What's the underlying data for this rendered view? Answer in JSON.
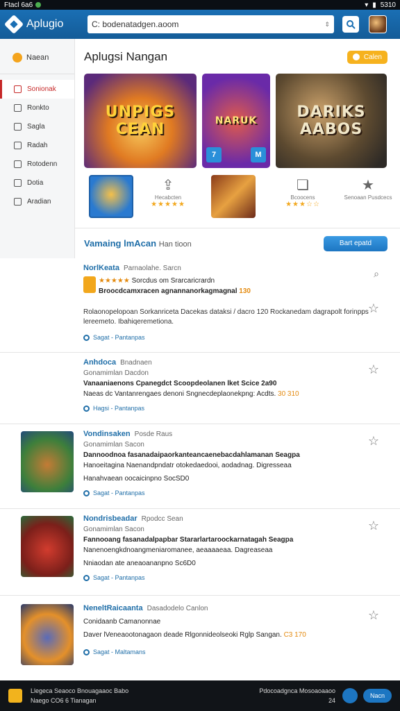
{
  "status": {
    "time": "Ftacl 6a6",
    "right": "5310"
  },
  "appbar": {
    "logo_text": "Aplugio",
    "search_value": "C: bodenatadgen.aoom"
  },
  "sidebar": {
    "top_label": "Naean",
    "items": [
      {
        "label": "Sonionak"
      },
      {
        "label": "Ronkto"
      },
      {
        "label": "Sagla"
      },
      {
        "label": "Radah"
      },
      {
        "label": "Rotodenn"
      },
      {
        "label": "Dotia"
      },
      {
        "label": "Aradian"
      }
    ]
  },
  "main": {
    "title": "Aplugsi Nangan",
    "get_button": "Calen",
    "banners": [
      {
        "text": "UNPIGS CEAN"
      },
      {
        "text": "NARUK"
      },
      {
        "text": "DARIKS AABOS"
      }
    ],
    "banner_badges": [
      "7",
      "M"
    ],
    "actions": [
      {
        "icon": "share-icon",
        "label": "Hecabcten",
        "stars": "★★★★★"
      },
      {
        "icon": "chat-icon",
        "label": "Bcoocens",
        "stars": "★★★☆☆"
      },
      {
        "icon": "star-icon",
        "label": "Senoaan Pusdcecs"
      }
    ],
    "section": {
      "title": "Vamaing",
      "accent": "lmAcan",
      "sub": "Han tioon",
      "button": "Bart epatd"
    },
    "list": [
      {
        "name": "NorlKeata",
        "dev": "Parnaolahe. Sarcn",
        "rating_line": "Sorcdus om Srarcaricrardn",
        "line1": "Broocdcamxracen agnannanorkagmagnal",
        "line1_num": "130",
        "desc": "Rolaonopelopoan Sorkanriceta Dacekas dataksi / dacro 120 Rockanedam dagrapolt forinpps lereemeto. Ibahiqeremetiona.",
        "tags": "Sagat - Pantanpas"
      },
      {
        "name": "Anhdoca",
        "dev": "Bnadnaen",
        "line0": "Gonamimlan Dacdon",
        "line1": "Vanaaniaenons Cpanegdct Scoopdeolanen lket Scice 2a90",
        "line2": "Naeas dc Vantanrengaes denoni Sngnecdeplaonekpng: Acdts.",
        "line2_num": "30 310",
        "tags": "Hagsi - Pantanpas"
      },
      {
        "name": "Vondinsaken",
        "dev": "Posde Raus",
        "line0": "Gonamimlan Sacon",
        "line1": "Dannoodnoa fasanadaipaorkanteancaenebacdahlamanan Seagpa",
        "line2": "Hanoeitagina Naenandpndatr otokedaedooi, aodadnag. Digresseaa",
        "line3": "Hanahvaean oocaicinpno SocSD0",
        "tags": "Sagat - Pantanpas"
      },
      {
        "name": "Nondrisbeadar",
        "dev": "Rpodcc Sean",
        "line0": "Gonamimlan Sacon",
        "line1": "Fannooang fasanadalpapbar Stararlartaroockarnatagah Seagpa",
        "line2": "Nanenoengkdnoangmeniaromanee, aeaaaaeaa. Dagreaseaa",
        "line3": "Nniaodan ate aneaoananpno Sc6D0",
        "tags": "Sagat - Pantanpas"
      },
      {
        "name": "NeneltRaicaanta",
        "dev": "Dasadodelo Canlon",
        "line0": "Conidaanb Camanonnae",
        "line1": "Daver lVeneaootonagaon deade Rlgonnideolseoki Rglp Sangan.",
        "line1_num": "C3 170",
        "tags": "Sagat - Maltamans"
      }
    ]
  },
  "bottom": {
    "left_line1": "Llegeca Seaoco Bnouagaaoc Babo",
    "left_line2": "Naego CO6 6 Tianagan",
    "right_line1": "Pdocoadgnca Mosoaoaaoo",
    "right_line2": "24",
    "pill": "Nacn"
  }
}
